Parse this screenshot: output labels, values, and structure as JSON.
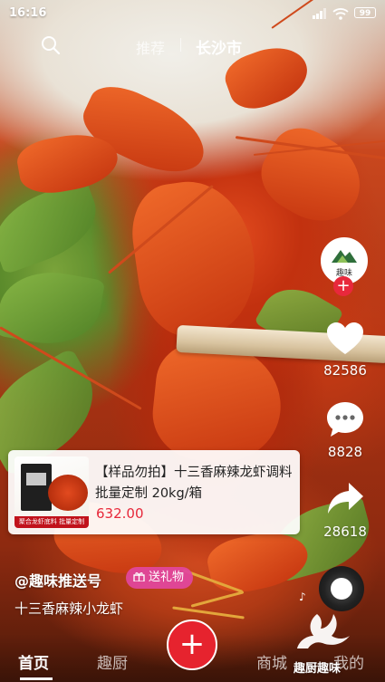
{
  "status_bar": {
    "time": "16:16",
    "battery": "99"
  },
  "top_nav": {
    "tab_recommend": "推荐",
    "tab_city": "长沙市"
  },
  "creator": {
    "avatar_text": "趣味"
  },
  "side_actions": {
    "likes": "82586",
    "comments": "8828",
    "shares": "28618"
  },
  "product": {
    "title": "【样品勿拍】十三香麻辣龙虾调料 批量定制 20kg/箱",
    "price": "632.00",
    "thumb_caption": "聚合龙虾底料 批量定制"
  },
  "post": {
    "author": "@趣味推送号",
    "gift_label": "送礼物",
    "caption": "十三香麻辣小龙虾"
  },
  "bottom_nav": {
    "home": "首页",
    "kitchen": "趣厨",
    "plus": "+",
    "mall": "商城",
    "mine": "我的"
  },
  "watermark": {
    "text": "趣厨趣味"
  },
  "colors": {
    "accent_red": "#e6232e",
    "price_red": "#e7283a",
    "gift_pink": "#e246a0"
  },
  "icons": [
    "search-icon",
    "heart-icon",
    "comment-icon",
    "share-icon",
    "music-disc-icon",
    "plus-icon",
    "gift-icon",
    "signal-icon",
    "wifi-icon",
    "battery-icon"
  ]
}
